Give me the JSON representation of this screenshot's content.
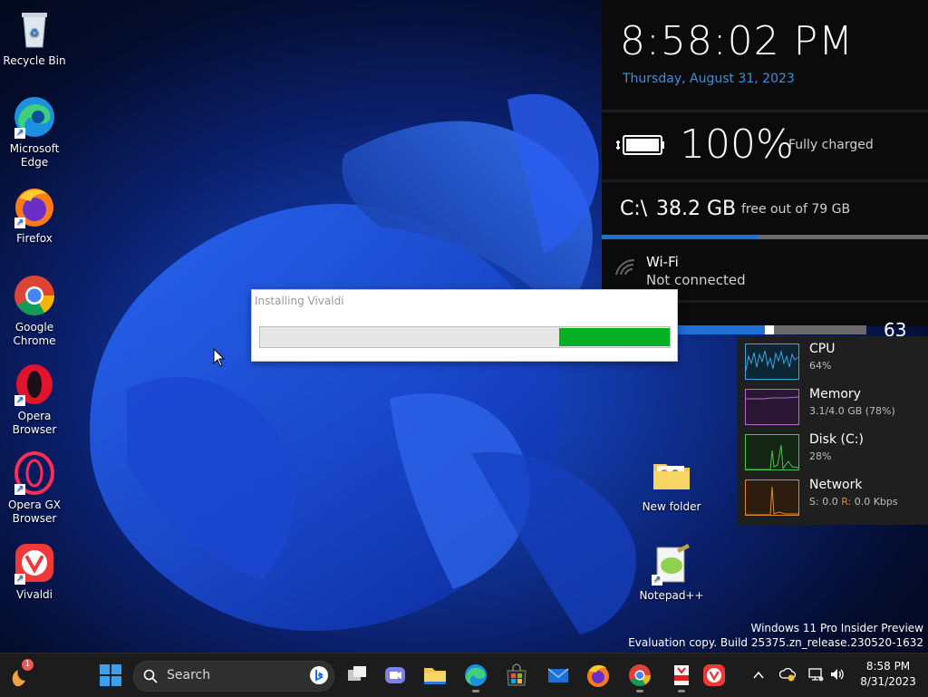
{
  "desktop": {
    "icons": [
      {
        "label": "Recycle Bin"
      },
      {
        "label": "Microsoft Edge"
      },
      {
        "label": "Firefox"
      },
      {
        "label": "Google Chrome"
      },
      {
        "label": "Opera Browser"
      },
      {
        "label": "Opera GX Browser"
      },
      {
        "label": "Vivaldi"
      },
      {
        "label": "New folder"
      },
      {
        "label": "Notepad++"
      }
    ],
    "watermark_line1": "Windows 11 Pro Insider Preview",
    "watermark_line2": "Evaluation copy. Build 25375.zn_release.230520-1632"
  },
  "widget": {
    "time": "8:58:02 PM",
    "date": "Thursday, August 31, 2023",
    "battery_percent": "100%",
    "battery_status": "Fully charged",
    "drive": "C:\\",
    "drive_free": "38.2 GB",
    "drive_total_text": "free out of 79 GB",
    "drive_free_fraction": 0.48,
    "wifi_title": "Wi-Fi",
    "wifi_status": "Not connected",
    "volume_value": "63",
    "volume_fraction": 0.63
  },
  "installer": {
    "title": "Installing Vivaldi",
    "progress_fraction": 0.27
  },
  "task_manager": {
    "cpu_label": "CPU",
    "cpu_value": "64%",
    "memory_label": "Memory",
    "memory_value": "3.1/4.0 GB (78%)",
    "disk_label": "Disk (C:)",
    "disk_value": "28%",
    "network_label": "Network",
    "network_s": "S:",
    "network_s_val": "0.0",
    "network_r": "R:",
    "network_r_val": "0.0 Kbps",
    "colors": {
      "cpu": "#3aa3e0",
      "memory": "#b06ad0",
      "disk": "#4cc44c",
      "network": "#e08a30"
    }
  },
  "taskbar": {
    "search_placeholder": "Search",
    "clock_time": "8:58 PM",
    "clock_date": "8/31/2023",
    "notification_badge": "1"
  },
  "colors": {
    "accent": "#1e6fd6",
    "progress": "#06b025"
  }
}
